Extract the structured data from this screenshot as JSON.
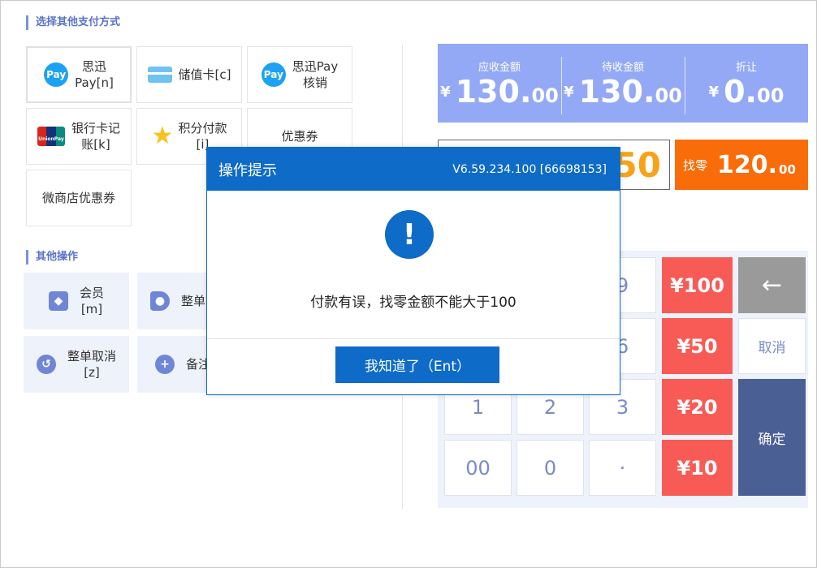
{
  "sections": {
    "pay_methods_title": "选择其他支付方式",
    "other_ops_title": "其他操作"
  },
  "pay_methods": [
    {
      "label": "思迅\nPay[n]",
      "icon": "pay-icon"
    },
    {
      "label": "储值卡[c]",
      "icon": "card-icon"
    },
    {
      "label": "思迅Pay\n核销",
      "icon": "pay-icon"
    },
    {
      "label": "银行卡记\n账[k]",
      "icon": "unionpay-icon"
    },
    {
      "label": "积分付款\n[i]",
      "icon": "star-icon"
    },
    {
      "label": "优惠券",
      "icon": ""
    },
    {
      "label": "微商店优惠券",
      "icon": ""
    }
  ],
  "icons": {
    "pay_text": "Pay",
    "unionpay_text": "UnionPay"
  },
  "other_ops": [
    {
      "label": "会员\n[m]",
      "icon": "diamond-icon"
    },
    {
      "label": "整单折",
      "icon": "tag-icon"
    },
    {
      "label": "整单取消\n[z]",
      "icon": "undo-icon"
    },
    {
      "label": "备注",
      "icon": "plus-icon"
    }
  ],
  "summary": {
    "currency": "¥",
    "receivable": {
      "label": "应收金额",
      "int": "130.",
      "dec": "00"
    },
    "pending": {
      "label": "待收金额",
      "int": "130.",
      "dec": "00"
    },
    "discount": {
      "label": "折让",
      "int": "0.",
      "dec": "00"
    }
  },
  "paid_amount": "250",
  "change": {
    "label": "找零",
    "int": "120.",
    "dec": "00"
  },
  "keypad": {
    "k9": "9",
    "k6": "6",
    "k1": "1",
    "k2": "2",
    "k3": "3",
    "k00": "00",
    "k0": "0",
    "kdot": "·",
    "q100": "¥100",
    "q50": "¥50",
    "q20": "¥20",
    "q10": "¥10",
    "back": "←",
    "cancel": "取消",
    "confirm": "确定"
  },
  "dialog": {
    "title": "操作提示",
    "version": "V6.59.234.100 [66698153]",
    "icon_glyph": "!",
    "message": "付款有误，找零金额不能大于100",
    "button": "我知道了（Ent）"
  },
  "colors": {
    "accent": "#0e6bc7",
    "summary_bg": "#94a9f5",
    "change_bg": "#f86d09",
    "quick_amount": "#f85b55",
    "confirm": "#4a5f94"
  }
}
